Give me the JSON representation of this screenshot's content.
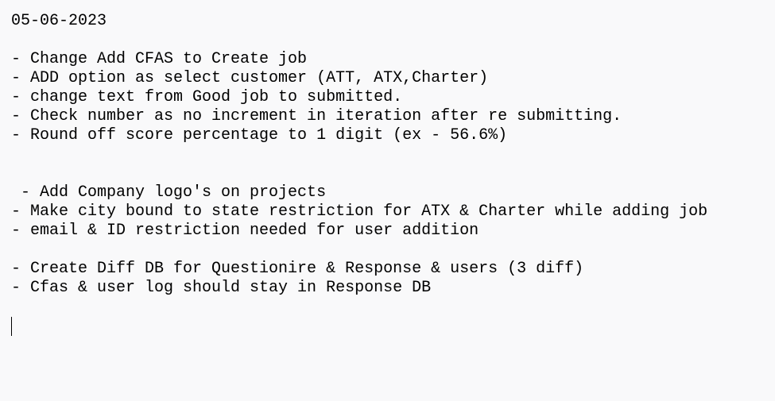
{
  "editor": {
    "lines": [
      "05-06-2023",
      "",
      "- Change Add CFAS to Create job",
      "- ADD option as select customer (ATT, ATX,Charter)",
      "- change text from Good job to submitted.",
      "- Check number as no increment in iteration after re submitting.",
      "- Round off score percentage to 1 digit (ex - 56.6%)",
      "",
      "",
      " - Add Company logo's on projects",
      "- Make city bound to state restriction for ATX & Charter while adding job",
      "- email & ID restriction needed for user addition",
      "",
      "- Create Diff DB for Questionire & Response & users (3 diff)",
      "- Cfas & user log should stay in Response DB",
      ""
    ]
  }
}
